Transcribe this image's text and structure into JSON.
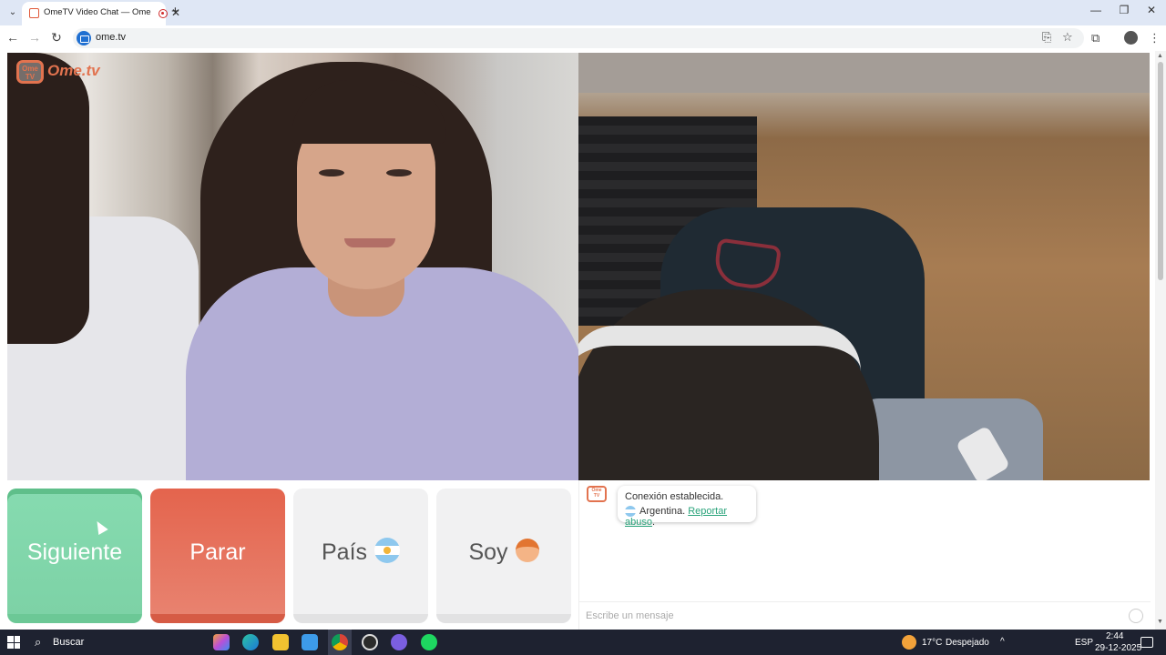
{
  "browser": {
    "tab_title": "OmeTV Video Chat — Ome",
    "tab_close": "✕",
    "new_tab": "+",
    "tab_menu": "⌄",
    "url": "ome.tv",
    "window_controls": {
      "minimize": "—",
      "maximize": "❐",
      "close": "✕"
    },
    "nav": {
      "back": "←",
      "forward": "→",
      "reload": "↻"
    },
    "icons": {
      "install": "⎘",
      "star": "☆",
      "extensions": "⧉",
      "menu": "⋮"
    }
  },
  "video": {
    "logo_tv": "Ome TV",
    "logo_text": "Ome.tv"
  },
  "buttons": {
    "next": "Siguiente",
    "stop": "Parar",
    "country": "País",
    "gender": "Soy"
  },
  "chat": {
    "logo_tv": "Ome TV",
    "message_line1": "Conexión establecida.",
    "message_country": "Argentina.",
    "report_link": "Reportar abuso",
    "period": ".",
    "input_placeholder": "Escribe un mensaje"
  },
  "taskbar": {
    "search_label": "Buscar",
    "weather_temp": "17°C",
    "weather_desc": "Despejado",
    "language": "ESP",
    "time": "2:44",
    "date": "29-12-2025",
    "tray_arrow": "^"
  },
  "colors": {
    "next_button": "#7dd2a6",
    "stop_button": "#e4644d",
    "brand_orange": "#e2734f",
    "link_green": "#29a37a"
  }
}
